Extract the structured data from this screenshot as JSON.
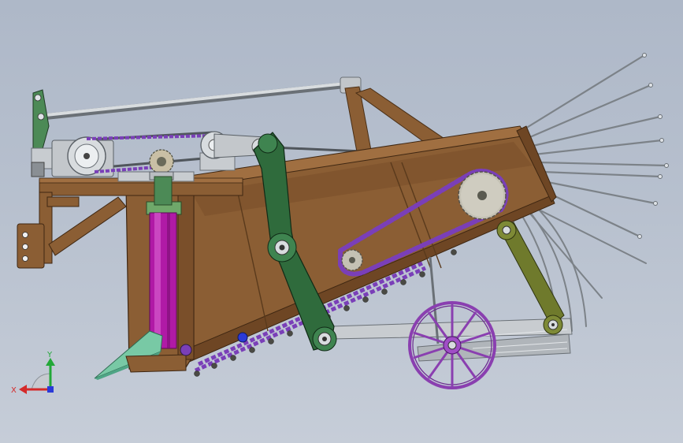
{
  "viewport": {
    "background_top": "#aeb8c8",
    "background_bottom": "#c6cdd8"
  },
  "colors": {
    "frame": "#8b5e34",
    "frame_dark": "#6e4624",
    "frame_light": "#a06f41",
    "link_green": "#2f6b3c",
    "arm_olive": "#6f7a2c",
    "chain_purple": "#7a3fb8",
    "wheel_purple": "#8a3fb0",
    "cylinder_magenta": "#b01aa6",
    "blade_green": "#78c9a5",
    "steel": "#c8ccd0",
    "steel_dark": "#7c8288",
    "mount_green": "#4c8a56"
  },
  "components": [
    {
      "name": "tine-rake-icon",
      "count": 8
    },
    {
      "name": "lower-tine-icon",
      "count": 5
    },
    {
      "name": "drive-sprocket-icon"
    },
    {
      "name": "chain-conveyor-icon"
    },
    {
      "name": "ground-wheel-icon",
      "spokes": 10
    },
    {
      "name": "hydraulic-cylinder-icon"
    },
    {
      "name": "digging-shovel-icon"
    },
    {
      "name": "crank-link-icon"
    },
    {
      "name": "pulley-icon"
    },
    {
      "name": "hitch-plate-icon"
    }
  ],
  "axis_triad": {
    "y_label": "Y",
    "x_label": "X",
    "y_color": "#22a838",
    "x_color": "#d42a2a",
    "z_color": "#2a3ad8"
  }
}
